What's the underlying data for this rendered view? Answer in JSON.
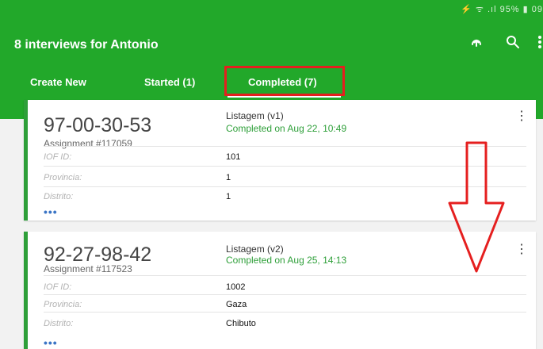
{
  "status": {
    "icons": "⚡ ᯤ .ıl 95% ▮ 09"
  },
  "header": {
    "title": "8 interviews for Antonio"
  },
  "actions": {
    "sync_icon": "sync-icon",
    "search_icon": "search-icon",
    "more_icon": "more-vert-icon"
  },
  "tabs": [
    {
      "label": "Create New"
    },
    {
      "label": "Started (1)"
    },
    {
      "label": "Completed (7)"
    }
  ],
  "cards": [
    {
      "id": "97-00-30-53",
      "assignment": "Assignment #117059",
      "version": "Listagem (v1)",
      "completed": "Completed on Aug 22, 10:49",
      "fields": [
        {
          "label": "IOF ID:",
          "value": "101"
        },
        {
          "label": "Provincia:",
          "value": "1"
        },
        {
          "label": "Distrito:",
          "value": "1"
        }
      ],
      "more": "•••"
    },
    {
      "id": "92-27-98-42",
      "assignment": "Assignment #117523",
      "version": "Listagem (v2)",
      "completed": "Completed on Aug 25, 14:13",
      "fields": [
        {
          "label": "IOF ID:",
          "value": "1002"
        },
        {
          "label": "Provincia:",
          "value": "Gaza"
        },
        {
          "label": "Distrito:",
          "value": "Chibuto"
        }
      ],
      "more": "•••"
    }
  ],
  "colors": {
    "primary": "#22a82a",
    "accent_red": "#e51f1f",
    "completed_text": "#2e9f39",
    "link_blue": "#3a74c5"
  }
}
